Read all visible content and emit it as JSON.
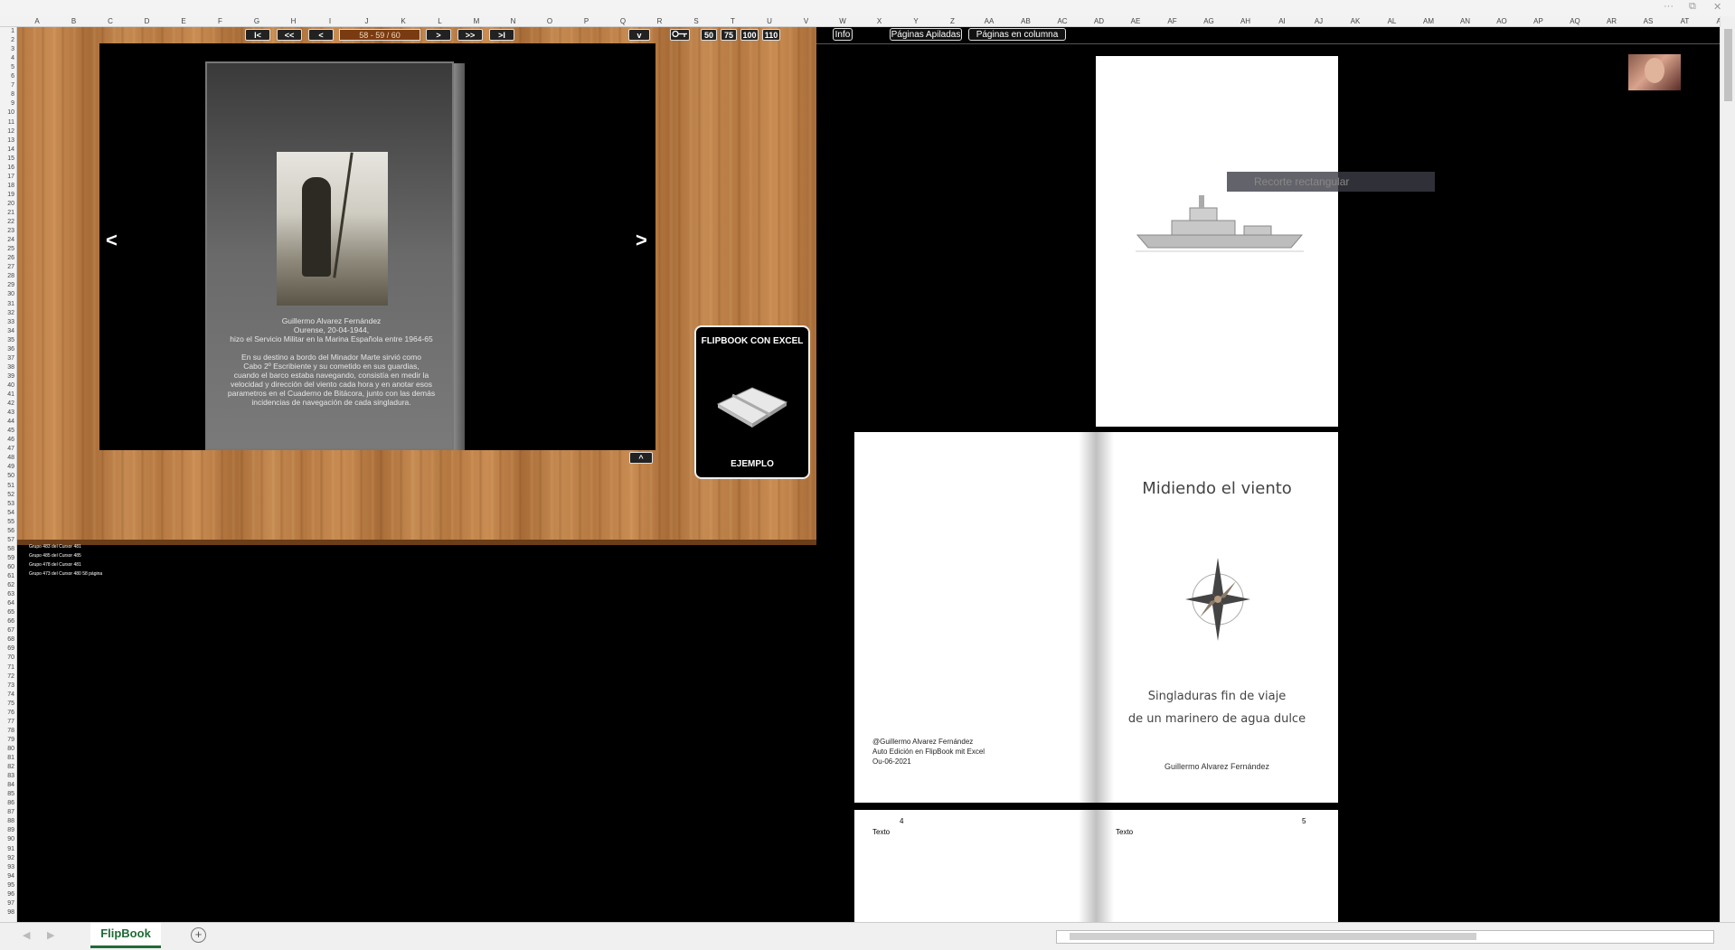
{
  "window": {
    "controls": [
      "···",
      "⧉",
      "✕"
    ]
  },
  "columns": [
    "A",
    "B",
    "C",
    "D",
    "E",
    "F",
    "G",
    "H",
    "I",
    "J",
    "K",
    "L",
    "M",
    "N",
    "O",
    "P",
    "Q",
    "R",
    "S",
    "T",
    "U",
    "V",
    "W",
    "X",
    "Y",
    "Z",
    "AA",
    "AB",
    "AC",
    "AD",
    "AE",
    "AF",
    "AG",
    "AH",
    "AI",
    "AJ",
    "AK",
    "AL",
    "AM",
    "AN",
    "AO",
    "AP",
    "AQ",
    "AR",
    "AS",
    "AT",
    "AU"
  ],
  "flipbook": {
    "first": "I<",
    "prev_fast": "<<",
    "prev": "<",
    "page_indicator": "58 - 59 / 60",
    "next": ">",
    "next_fast": ">>",
    "last": ">I",
    "dropdown": "v",
    "key_icon": "key-icon",
    "zoom": [
      "50",
      "75",
      "100",
      "110"
    ],
    "stage_prev": "<",
    "stage_next": ">",
    "collapse": "^",
    "marker": "8"
  },
  "book_page": {
    "bio_lines": [
      "Guillermo Alvarez Fernández",
      "Ourense,  20-04-1944,",
      "hizo el Servicio Militar en la Marina Española entre 1964-65",
      "",
      "En su destino a bordo del Minador Marte sirvió como",
      "Cabo 2º Escribiente y su cometido en sus guardias,",
      "cuando el barco estaba navegando, consistía en medir la",
      "velocidad y dirección del viento cada hora y en anotar esos",
      "parametros en el Cuaderno de Bitácora, junto con las demás",
      "incidencias de navegación de cada singladura."
    ]
  },
  "side_card": {
    "title": "FLIPBOOK CON EXCEL",
    "subtitle": "EJEMPLO"
  },
  "small_lines": [
    "Grupo 483 del Cursor 481",
    "Grupo 485 del Cursor 485",
    "Grupo 478 del Cursor 481",
    "Grupo 473 del Cursor 480      58 página"
  ],
  "right_toolbar": {
    "info": "Info",
    "stacked": "Páginas Apiladas",
    "column": "Páginas en columna"
  },
  "ghost_label": "Recorte rectangular",
  "cover_page": {
    "title": "Midiendo el viento",
    "subtitle_line1": "Singladuras fin de viaje",
    "subtitle_line2": "de un marinero de agua dulce",
    "author": "Guillermo Alvarez Fernández",
    "credits": [
      "@Guillermo Alvarez Fernández",
      "Auto Edición en FlipBook mit Excel",
      "Ou-06-2021"
    ]
  },
  "text_pages": {
    "left_num": "4",
    "right_num": "5",
    "left_text": "Texto",
    "right_text": "Texto"
  },
  "sheet_tab": "FlipBook",
  "add_sheet": "+"
}
